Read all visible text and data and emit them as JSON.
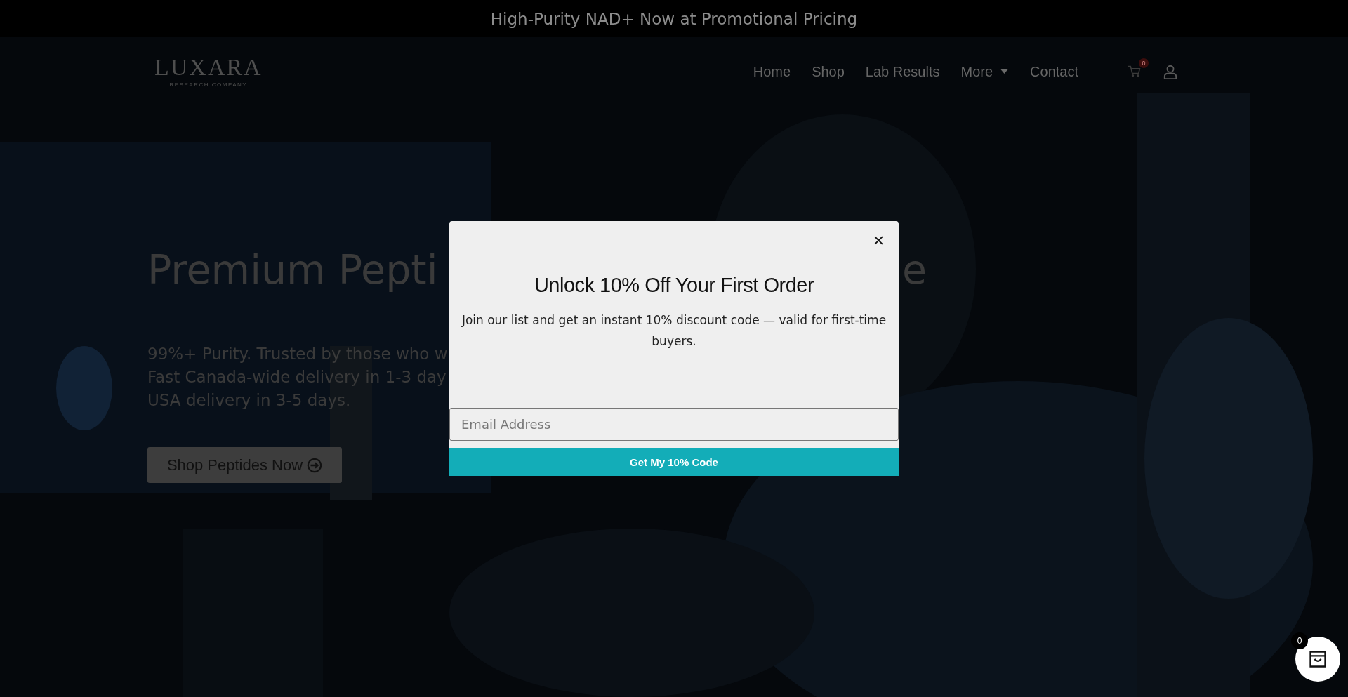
{
  "announcement": "High-Purity NAD+ Now at Promotional Pricing",
  "header": {
    "logo": {
      "name": "LUXARA",
      "tagline": "RESEARCH COMPANY"
    },
    "nav": [
      {
        "label": "Home",
        "has_dropdown": false
      },
      {
        "label": "Shop",
        "has_dropdown": false
      },
      {
        "label": "Lab Results",
        "has_dropdown": false
      },
      {
        "label": "More",
        "has_dropdown": true
      },
      {
        "label": "Contact",
        "has_dropdown": false
      }
    ],
    "cart_count": "0"
  },
  "hero": {
    "kind": "picture",
    "title_parts": [
      "Premium Pepti",
      "e"
    ],
    "lines": [
      "99%+ Purity. Trusted by those who w",
      "Fast Canada-wide delivery in 1-3 day",
      "USA delivery in 3-5 days."
    ],
    "button": "Shop Peptides Now"
  },
  "popup": {
    "title": "Unlock 10% Off Your First Order",
    "text": "Join our list and get an instant 10% discount code — valid for first-time buyers.",
    "email": {
      "placeholder": "Email Address"
    },
    "button": "Get My 10% Code"
  },
  "floating_cart": {
    "count": "0"
  }
}
